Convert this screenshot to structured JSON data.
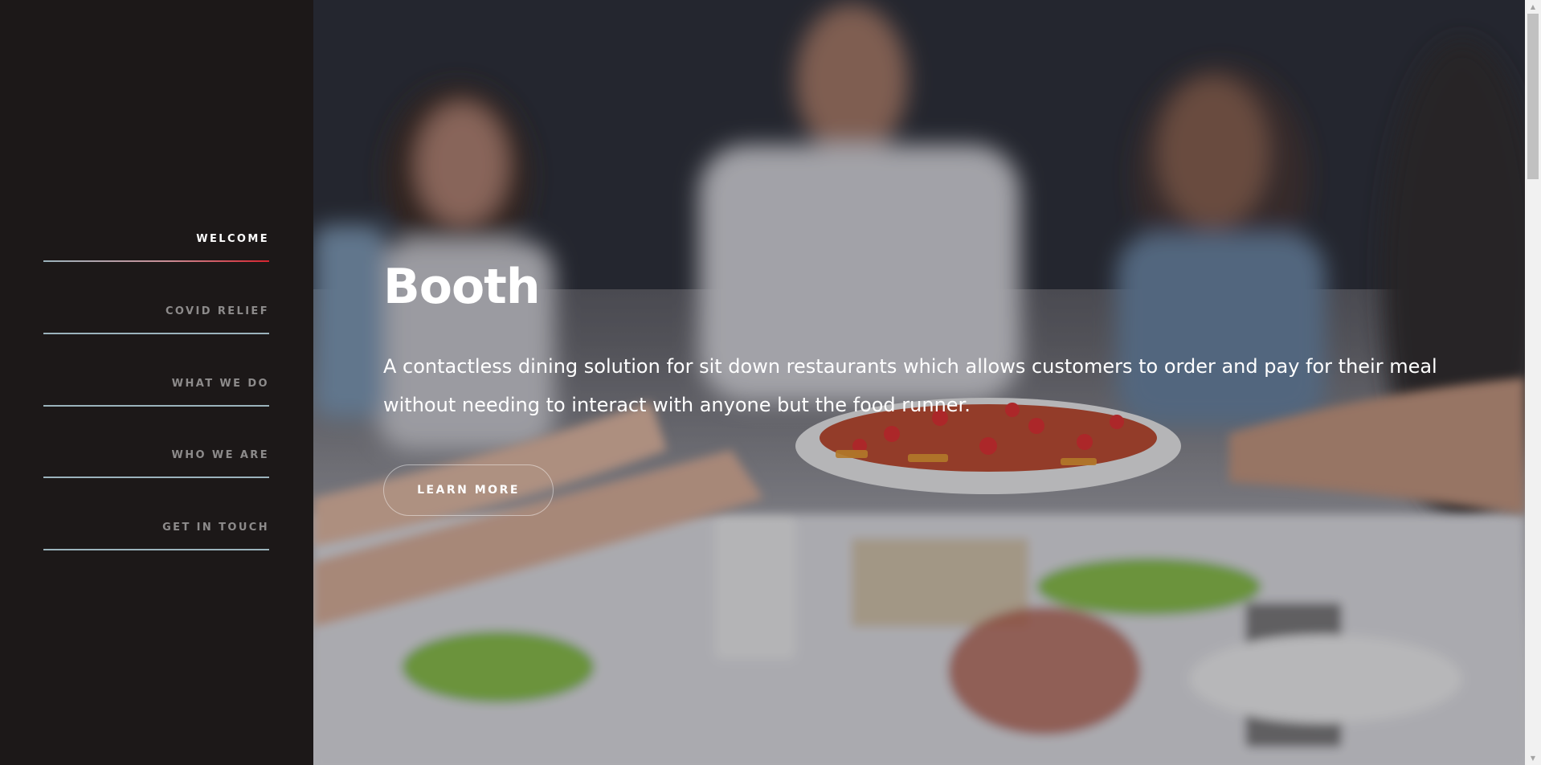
{
  "nav": {
    "items": [
      {
        "label": "WELCOME",
        "active": true
      },
      {
        "label": "COVID RELIEF",
        "active": false
      },
      {
        "label": "WHAT WE DO",
        "active": false
      },
      {
        "label": "WHO WE ARE",
        "active": false
      },
      {
        "label": "GET IN TOUCH",
        "active": false
      }
    ]
  },
  "hero": {
    "title": "Booth",
    "description": "A contactless dining solution for sit down restaurants which allows customers to order and pay for their meal without needing to interact with anyone but the food runner.",
    "cta_label": "LEARN MORE",
    "background_image": "people-sharing-meal-photo"
  },
  "colors": {
    "sidebar_bg": "#1c1818",
    "nav_active": "#ffffff",
    "nav_inactive": "#8d8b8b",
    "underline": "#9bb3bc",
    "accent_red": "#d6242f"
  },
  "scrollbar": {
    "up_icon": "triangle-up",
    "down_icon": "triangle-down"
  }
}
